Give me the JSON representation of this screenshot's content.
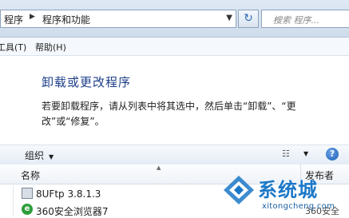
{
  "address": {
    "crumbs": [
      "程序",
      "程序和功能"
    ],
    "search_placeholder": "搜索 程序..."
  },
  "menu": {
    "items": [
      "工具(T)",
      "帮助(H)"
    ]
  },
  "main": {
    "title": "卸载或更改程序",
    "description": "若要卸载程序，请从列表中将其选中，然后单击“卸载”、“更改”或“修复”。"
  },
  "toolbar": {
    "organize_label": "组织"
  },
  "list": {
    "columns": {
      "name": "名称",
      "publisher": "发布者"
    },
    "rows": [
      {
        "name": "8UFtp 3.8.1.3",
        "publisher": ""
      },
      {
        "name": "360安全浏览器7",
        "publisher": "360安全"
      }
    ]
  },
  "watermark": {
    "brand": "系统城",
    "url": "xitongcheng.com"
  },
  "colors": {
    "title_blue": "#1e3f8a",
    "watermark_blue": "#1b78c8"
  }
}
